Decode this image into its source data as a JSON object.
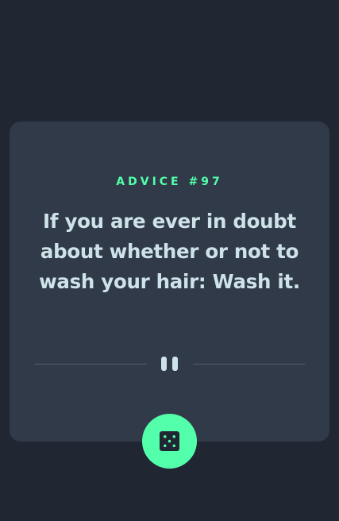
{
  "advice": {
    "id_label": "ADVICE #97",
    "quote": "If you are ever in doubt about whether or not to wash your hair: Wash it."
  },
  "colors": {
    "background": "#202632",
    "card": "#313a48",
    "accent": "#53ffaa",
    "text": "#cee3e9",
    "divider": "#4f5d74"
  },
  "icons": {
    "divider": "pause-icon",
    "button": "dice-icon"
  }
}
